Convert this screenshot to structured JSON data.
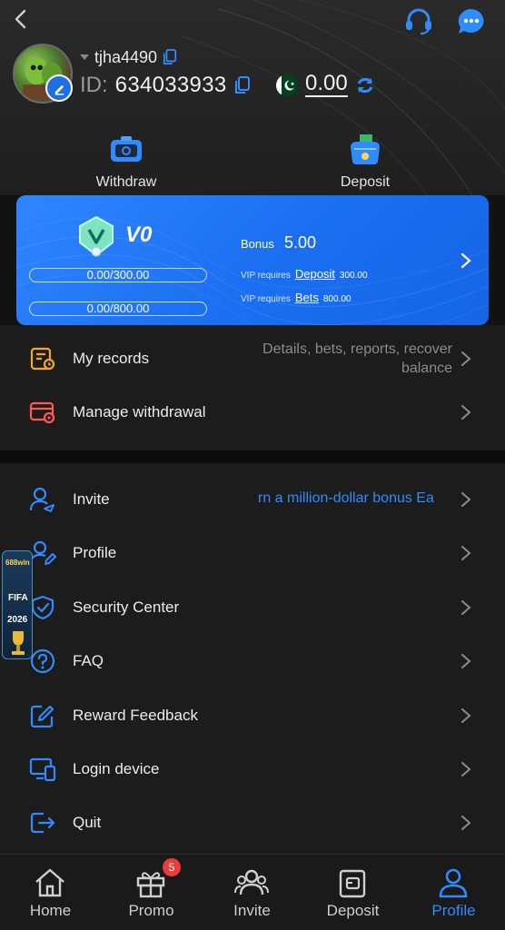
{
  "header": {
    "username": "tjha4490",
    "id_label": "ID:",
    "id_value": "634033933",
    "balance": "0.00"
  },
  "quick_actions": [
    {
      "label": "Withdraw",
      "icon": "wallet-icon"
    },
    {
      "label": "Deposit",
      "icon": "coin-purse-icon"
    }
  ],
  "vip": {
    "level": "V0",
    "progress_deposit": "0.00/300.00",
    "progress_bets": "0.00/800.00",
    "bonus_label": "Bonus",
    "bonus_value": "5.00",
    "req_deposit_prefix": "VIP requires",
    "req_deposit_link": "Deposit",
    "req_deposit_amount": "300.00",
    "req_bets_prefix": "VIP requires",
    "req_bets_link": "Bets",
    "req_bets_amount": "800.00"
  },
  "menu_top": {
    "records_label": "My records",
    "records_hint_1": "Details, bets, reports, recover",
    "records_hint_2": "balance",
    "withdrawal_label": "Manage withdrawal"
  },
  "menu_main": {
    "invite_label": "Invite",
    "invite_marquee": "rn a million-dollar bonus  Ea",
    "profile_label": "Profile",
    "security_label": "Security Center",
    "faq_label": "FAQ",
    "feedback_label": "Reward Feedback",
    "login_device_label": "Login device",
    "quit_label": "Quit"
  },
  "float_banner": {
    "brand": "688win",
    "line1": "FIFA",
    "line2": "2026"
  },
  "tabbar": {
    "home": "Home",
    "promo": "Promo",
    "promo_badge": "5",
    "invite": "Invite",
    "deposit": "Deposit",
    "profile": "Profile"
  },
  "colors": {
    "accent": "#2f8bff",
    "vip_card": "#1a6ef0",
    "badge": "#ef3b3b",
    "icon_orange": "#f5a623",
    "icon_red": "#ff5a52"
  }
}
